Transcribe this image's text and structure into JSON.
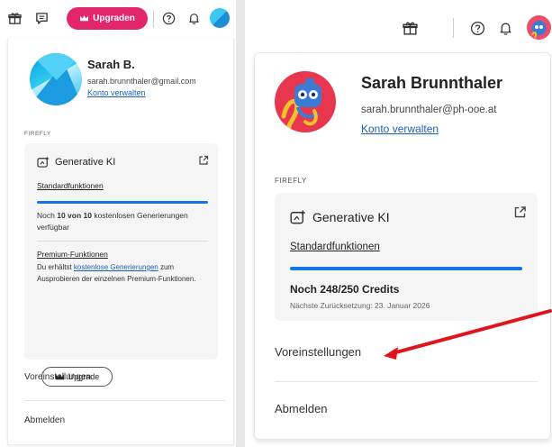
{
  "colors": {
    "accent": "#e3266b",
    "link": "#1c5fb8",
    "progress": "#1473e6",
    "annotation_arrow": "#e0141c"
  },
  "left_panel": {
    "topbar": {
      "icons": [
        "gift-icon",
        "chat-icon",
        "help-icon",
        "bell-icon",
        "avatar"
      ],
      "upgrade_label": "Upgraden"
    },
    "profile": {
      "name": "Sarah B.",
      "email": "sarah.brunnthaler@gmail.com",
      "manage_account": "Konto verwalten"
    },
    "section_label": "FIREFLY",
    "card": {
      "title": "Generative KI",
      "standard_label": "Standardfunktionen",
      "progress": 1.0,
      "credits_pre": "Noch ",
      "credits_bold": "10 von 10",
      "credits_post": " kostenlosen Generierungen verfügbar",
      "premium_label": "Premium-Funktionen",
      "premium_text_pre": "Du erhältst ",
      "premium_link": "kostenlose Generierungen",
      "premium_text_post": " zum Ausprobieren der einzelnen Premium-Funktionen.",
      "upgrade_button": "Upgrade"
    },
    "menu": {
      "preferences": "Voreinstellungen",
      "sign_out": "Abmelden"
    }
  },
  "right_panel": {
    "topbar": {
      "icons": [
        "gift-icon",
        "help-icon",
        "bell-icon",
        "avatar"
      ]
    },
    "profile": {
      "name": "Sarah Brunnthaler",
      "email": "sarah.brunnthaler@ph-ooe.at",
      "manage_account": "Konto verwalten"
    },
    "section_label": "FIREFLY",
    "card": {
      "title": "Generative KI",
      "standard_label": "Standardfunktionen",
      "progress": 0.992,
      "credits": "Noch 248/250 Credits",
      "reset_text": "Nächste Zurücksetzung: 23. Januar 2026"
    },
    "menu": {
      "preferences": "Voreinstellungen",
      "sign_out": "Abmelden"
    }
  }
}
